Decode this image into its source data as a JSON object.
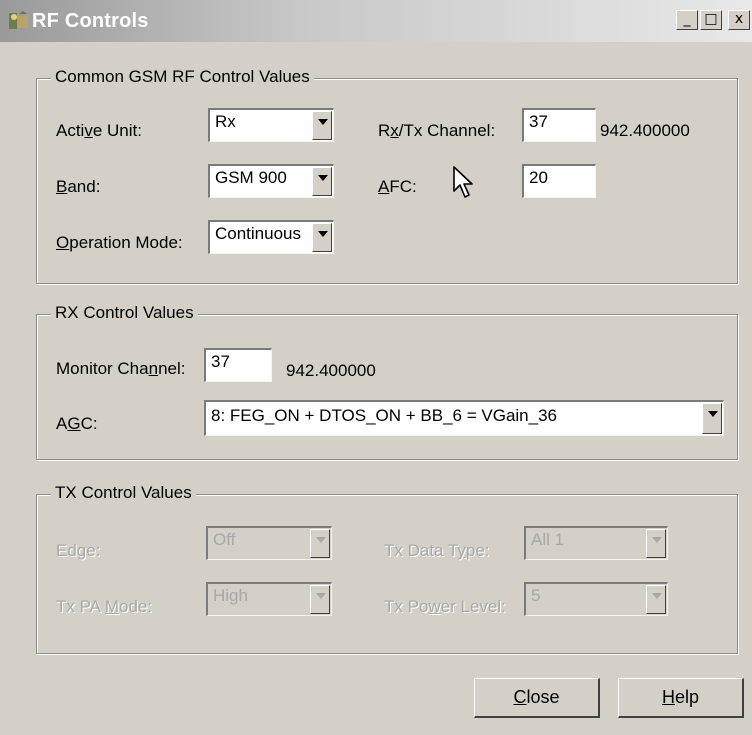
{
  "window": {
    "title": "RF Controls",
    "minimize_glyph": "_",
    "maximize_glyph": "□",
    "close_glyph": "x"
  },
  "common": {
    "legend": "Common GSM RF Control Values",
    "active_unit_label": "Active Unit:",
    "active_unit_value": "Rx",
    "band_label": "Band:",
    "band_value": "GSM 900",
    "op_mode_label": "Operation Mode:",
    "op_mode_value": "Continuous",
    "channel_label": "Rx/Tx Channel:",
    "channel_value": "37",
    "channel_freq": "942.400000",
    "afc_label": "AFC:",
    "afc_value": "20"
  },
  "rx": {
    "legend": "RX Control Values",
    "monitor_label": "Monitor Channel:",
    "monitor_value": "37",
    "monitor_freq": "942.400000",
    "agc_label": "AGC:",
    "agc_value": "8: FEG_ON + DTOS_ON + BB_6 = VGain_36"
  },
  "tx": {
    "legend": "TX Control Values",
    "edge_label": "Edge:",
    "edge_value": "Off",
    "data_type_label": "Tx Data Type:",
    "data_type_value": "All 1",
    "pa_mode_label": "Tx PA Mode:",
    "pa_mode_value": "High",
    "power_label": "Tx Power Level:",
    "power_value": "5"
  },
  "buttons": {
    "close": "Close",
    "help": "Help"
  },
  "icons": {
    "app": "rf-app-icon",
    "dropdown": "chevron-down-icon",
    "cursor": "mouse-pointer-icon"
  }
}
